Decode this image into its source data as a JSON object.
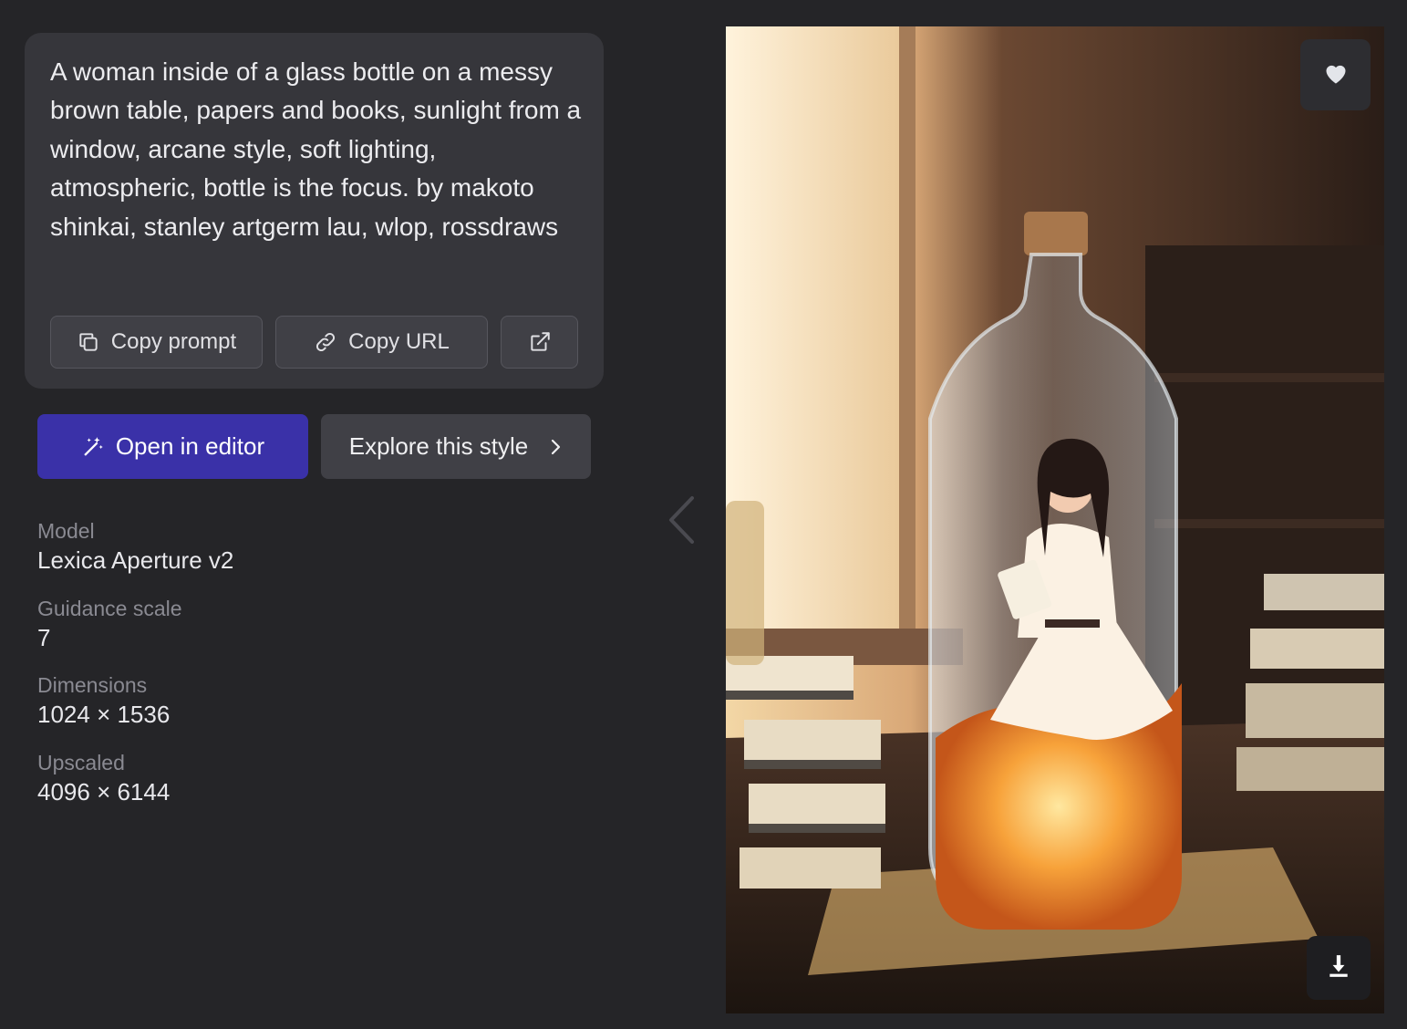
{
  "prompt": {
    "text": "A woman inside of a glass bottle on a messy brown table, papers and books, sunlight from a window, arcane style, soft lighting, atmospheric, bottle is the focus. by makoto shinkai, stanley artgerm lau, wlop, rossdraws",
    "copy_prompt_label": "Copy prompt",
    "copy_url_label": "Copy URL",
    "external_icon": "external-link-icon"
  },
  "actions": {
    "open_editor_label": "Open in editor",
    "explore_label": "Explore this style"
  },
  "metadata": [
    {
      "label": "Model",
      "value": "Lexica Aperture v2"
    },
    {
      "label": "Guidance scale",
      "value": "7"
    },
    {
      "label": "Dimensions",
      "value": "1024 × 1536"
    },
    {
      "label": "Upscaled",
      "value": "4096 × 6144"
    }
  ],
  "image": {
    "description_icon": "generated-image",
    "favorite_icon": "heart-icon",
    "download_icon": "download-icon"
  },
  "colors": {
    "background": "#252528",
    "card": "#36363b",
    "primary": "#3a31a8",
    "secondary": "#404046"
  }
}
